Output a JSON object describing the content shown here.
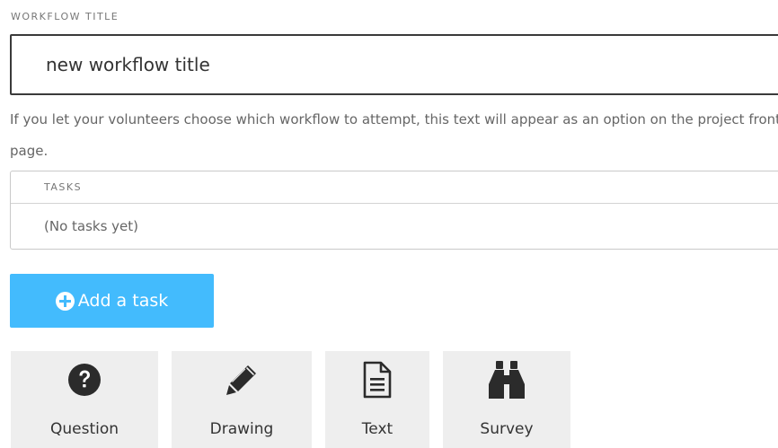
{
  "workflow_title": {
    "label": "WORKFLOW TITLE",
    "value": "new workflow title"
  },
  "help_text": "If you let your volunteers choose which workflow to attempt, this text will appear as an option on the project front page.",
  "tasks": {
    "header": "TASKS",
    "empty_text": "(No tasks yet)"
  },
  "add_task": {
    "label": "Add a task",
    "icon": "plus-circle-icon",
    "color": "#43bbfd"
  },
  "task_types": [
    {
      "label": "Question",
      "icon": "question-circle-icon"
    },
    {
      "label": "Drawing",
      "icon": "pencil-icon"
    },
    {
      "label": "Text",
      "icon": "file-text-icon"
    },
    {
      "label": "Survey",
      "icon": "binoculars-icon"
    }
  ]
}
